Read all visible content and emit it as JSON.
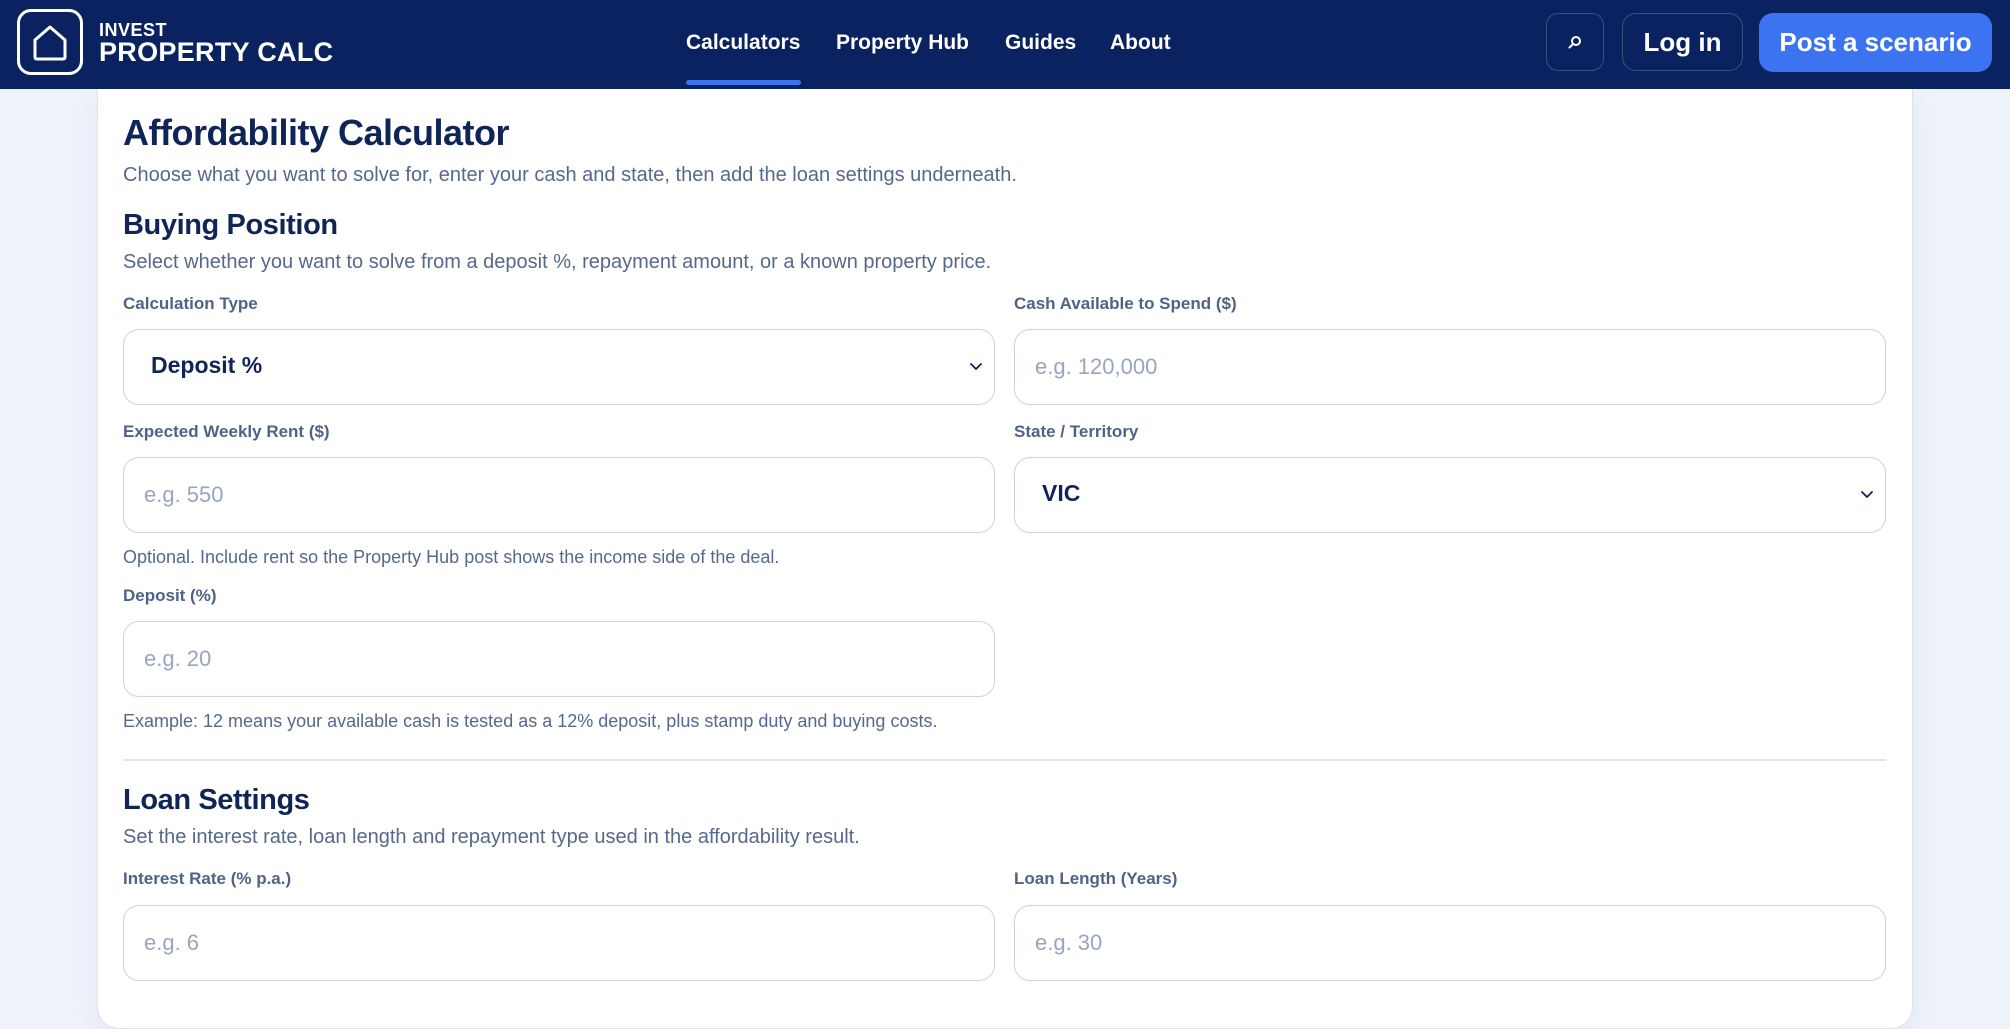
{
  "brand": {
    "line1": "INVEST",
    "line2": "PROPERTY CALC"
  },
  "nav": {
    "items": [
      "Calculators",
      "Property Hub",
      "Guides",
      "About"
    ],
    "active": "Calculators"
  },
  "header_actions": {
    "login": "Log in",
    "post": "Post a scenario",
    "search_icon": "search-icon"
  },
  "colors": {
    "navy": "#0b2260",
    "accent": "#3b73f0",
    "text": "#0f2557",
    "muted": "#55698a"
  },
  "page": {
    "title": "Affordability Calculator",
    "subtitle": "Choose what you want to solve for, enter your cash and state, then add the loan settings underneath."
  },
  "buying": {
    "title": "Buying Position",
    "subtitle": "Select whether you want to solve from a deposit %, repayment amount, or a known property price.",
    "calc_type": {
      "label": "Calculation Type",
      "value": "Deposit %"
    },
    "cash": {
      "label": "Cash Available to Spend ($)",
      "placeholder": "e.g. 120,000"
    },
    "rent": {
      "label": "Expected Weekly Rent ($)",
      "placeholder": "e.g. 550",
      "hint": "Optional. Include rent so the Property Hub post shows the income side of the deal."
    },
    "state": {
      "label": "State / Territory",
      "value": "VIC"
    },
    "deposit": {
      "label": "Deposit (%)",
      "placeholder": "e.g. 20",
      "hint": "Example: 12 means your available cash is tested as a 12% deposit, plus stamp duty and buying costs."
    }
  },
  "loan": {
    "title": "Loan Settings",
    "subtitle": "Set the interest rate, loan length and repayment type used in the affordability result.",
    "rate": {
      "label": "Interest Rate (% p.a.)",
      "placeholder": "e.g. 6"
    },
    "length": {
      "label": "Loan Length (Years)",
      "placeholder": "e.g. 30"
    }
  }
}
